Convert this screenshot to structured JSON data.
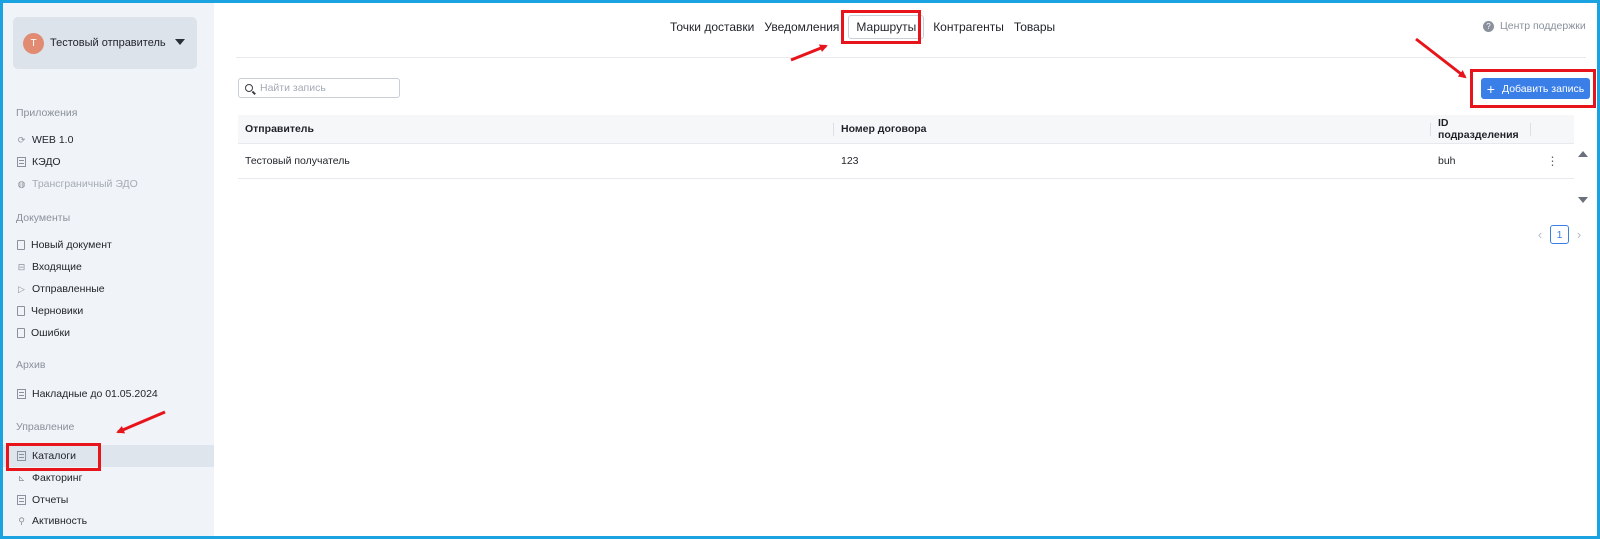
{
  "account": {
    "initial": "T",
    "name": "Тестовый отправитель"
  },
  "sidebar": {
    "sections": [
      {
        "title": "Приложения"
      },
      {
        "title": "Документы"
      },
      {
        "title": "Архив"
      },
      {
        "title": "Управление"
      }
    ],
    "apps": [
      {
        "label": "WEB 1.0",
        "icon": "sync-icon"
      },
      {
        "label": "КЭДО",
        "icon": "document-list-icon"
      },
      {
        "label": "Трансграничный ЭДО",
        "icon": "globe-icon",
        "disabled": true
      }
    ],
    "documents": [
      {
        "label": "Новый документ",
        "icon": "new-document-icon"
      },
      {
        "label": "Входящие",
        "icon": "inbox-icon"
      },
      {
        "label": "Отправленные",
        "icon": "send-icon"
      },
      {
        "label": "Черновики",
        "icon": "draft-icon"
      },
      {
        "label": "Ошибки",
        "icon": "error-document-icon"
      }
    ],
    "archive": [
      {
        "label": "Накладные до 01.05.2024",
        "icon": "list-icon"
      }
    ],
    "management": [
      {
        "label": "Каталоги",
        "icon": "catalog-icon",
        "active": true
      },
      {
        "label": "Факторинг",
        "icon": "chart-icon"
      },
      {
        "label": "Отчеты",
        "icon": "report-icon"
      },
      {
        "label": "Активность",
        "icon": "search-icon"
      }
    ]
  },
  "tabs": [
    {
      "label": "Точки доставки"
    },
    {
      "label": "Уведомления"
    },
    {
      "label": "Маршруты",
      "active": true
    },
    {
      "label": "Контрагенты"
    },
    {
      "label": "Товары"
    }
  ],
  "help": {
    "label": "Центр поддержки"
  },
  "search": {
    "placeholder": "Найти запись",
    "value": ""
  },
  "add_button": {
    "label": "Добавить запись"
  },
  "table": {
    "columns": [
      "Отправитель",
      "Номер договора",
      "ID подразделения"
    ],
    "rows": [
      {
        "sender": "Тестовый получатель",
        "contract": "123",
        "unit_id": "buh"
      }
    ]
  },
  "pagination": {
    "current": "1"
  },
  "colors": {
    "accent": "#3a7ee8",
    "highlight": "#e8141b",
    "frame": "#1aa3e0"
  }
}
